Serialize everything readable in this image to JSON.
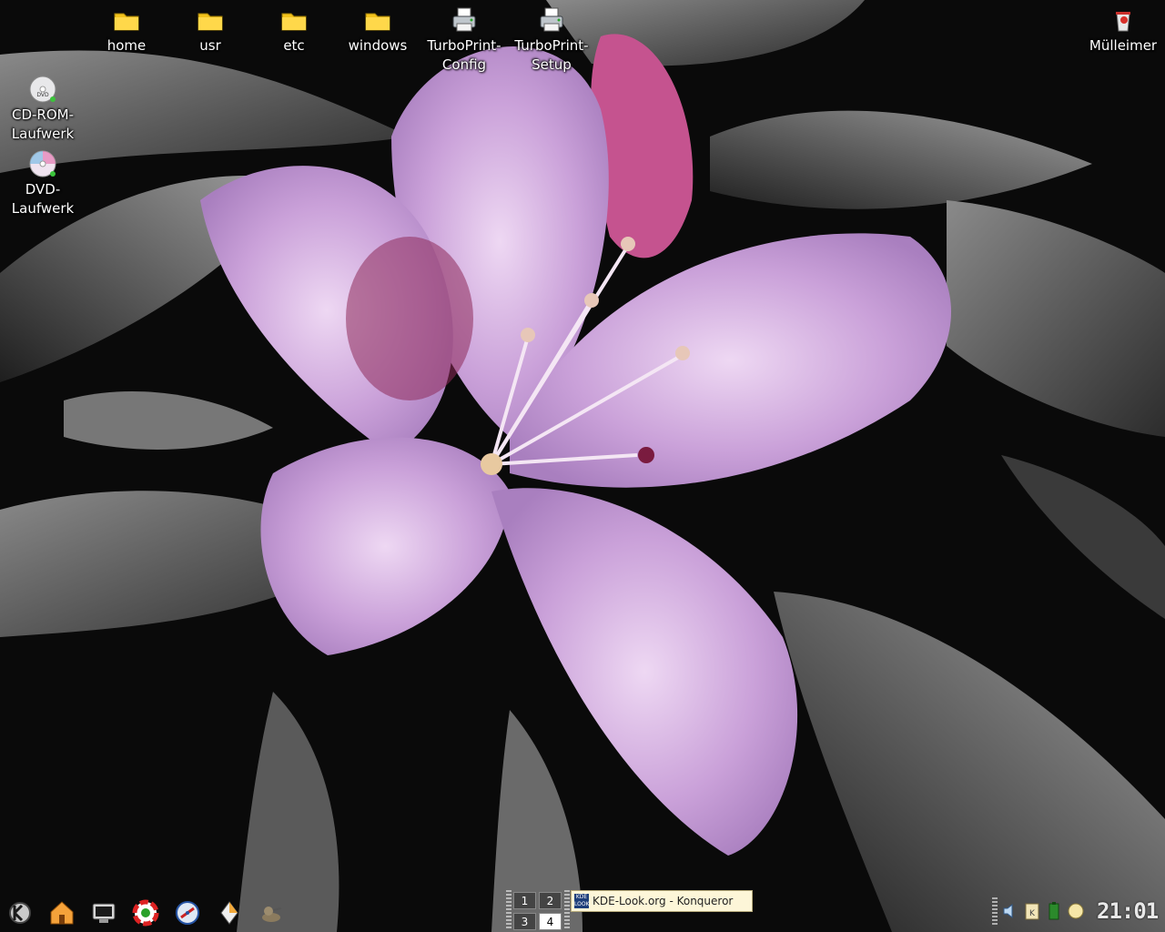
{
  "desktop": {
    "icons": [
      {
        "label": "home",
        "icon": "folder-icon"
      },
      {
        "label": "usr",
        "icon": "folder-icon"
      },
      {
        "label": "etc",
        "icon": "folder-icon"
      },
      {
        "label": "windows",
        "icon": "folder-icon"
      },
      {
        "label": "TurboPrint-\nConfig",
        "icon": "printer-icon"
      },
      {
        "label": "TurboPrint-\nSetup",
        "icon": "printer-icon"
      },
      {
        "label": "Mülleimer",
        "icon": "trash-icon"
      },
      {
        "label": "CD-ROM-\nLaufwerk",
        "icon": "dvd-drive-icon"
      },
      {
        "label": "DVD-\nLaufwerk",
        "icon": "cdrom-drive-icon"
      }
    ]
  },
  "panel": {
    "launchers": [
      {
        "name": "kde-menu-icon"
      },
      {
        "name": "home-icon"
      },
      {
        "name": "terminal-icon"
      },
      {
        "name": "help-icon"
      },
      {
        "name": "konqueror-icon"
      },
      {
        "name": "kate-icon"
      },
      {
        "name": "gimp-icon"
      }
    ],
    "pager": {
      "desktops": [
        "1",
        "2",
        "3",
        "4"
      ],
      "active": "4"
    },
    "task": {
      "badge_text": "KDE\nLOOK",
      "label": "KDE-Look.org - Konqueror"
    },
    "tray": [
      "speaker-icon",
      "klipper-icon",
      "battery-icon",
      "moon-icon"
    ],
    "clock": "21:01"
  },
  "colors": {
    "petal": "#c89ad8",
    "accent": "#a83a76",
    "taskbar_button": "#fdf6d8"
  }
}
